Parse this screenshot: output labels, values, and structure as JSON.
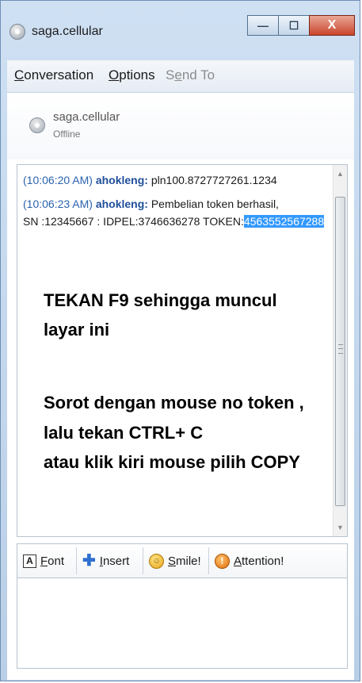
{
  "window": {
    "title": "saga.cellular",
    "controls": {
      "minimize": "—",
      "maximize": "☐",
      "close": "X"
    }
  },
  "menu": {
    "conversation": {
      "key": "C",
      "rest": "onversation"
    },
    "options": {
      "key": "O",
      "rest": "ptions"
    },
    "send_to": {
      "pre": "S",
      "key": "e",
      "rest": "nd To"
    }
  },
  "contact": {
    "name": "saga.cellular",
    "status": "Offline"
  },
  "messages": [
    {
      "time": "(10:06:20 AM)",
      "sender": "ahokleng:",
      "text": "pln100.8727727261.1234"
    },
    {
      "time": "(10:06:23 AM)",
      "sender": "ahokleng:",
      "text": "Pembelian token berhasil,",
      "line2": "SN :12345667 : IDPEL:3746636278 TOKEN:",
      "token": "4563552567288"
    }
  ],
  "overlay": {
    "line1": "TEKAN F9 sehingga muncul",
    "line2": "layar ini",
    "line3": "Sorot dengan mouse no token ,",
    "line4": "lalu tekan CTRL+ C",
    "line5": "atau klik kiri mouse pilih COPY"
  },
  "toolbar": {
    "font": {
      "icon": "A",
      "key": "F",
      "rest": "ont"
    },
    "insert": {
      "icon": "✚",
      "key": "I",
      "rest": "nsert"
    },
    "smile": {
      "icon": "☺",
      "key": "S",
      "rest": "mile!"
    },
    "attention": {
      "icon": "!",
      "key": "A",
      "rest": "ttention!"
    }
  },
  "scrollbar": {
    "up": "▲",
    "down": "▼"
  },
  "icons": {
    "app": "messenger-offline-icon",
    "contact": "offline-status-icon",
    "font": "font-icon",
    "insert": "insert-plus-icon",
    "smile": "smiley-icon",
    "attention": "attention-icon"
  },
  "colors": {
    "selection": "#3399ff",
    "timestamp": "#2a63b0",
    "nickname": "#1f4f9a",
    "close_button": "#c9452d"
  }
}
